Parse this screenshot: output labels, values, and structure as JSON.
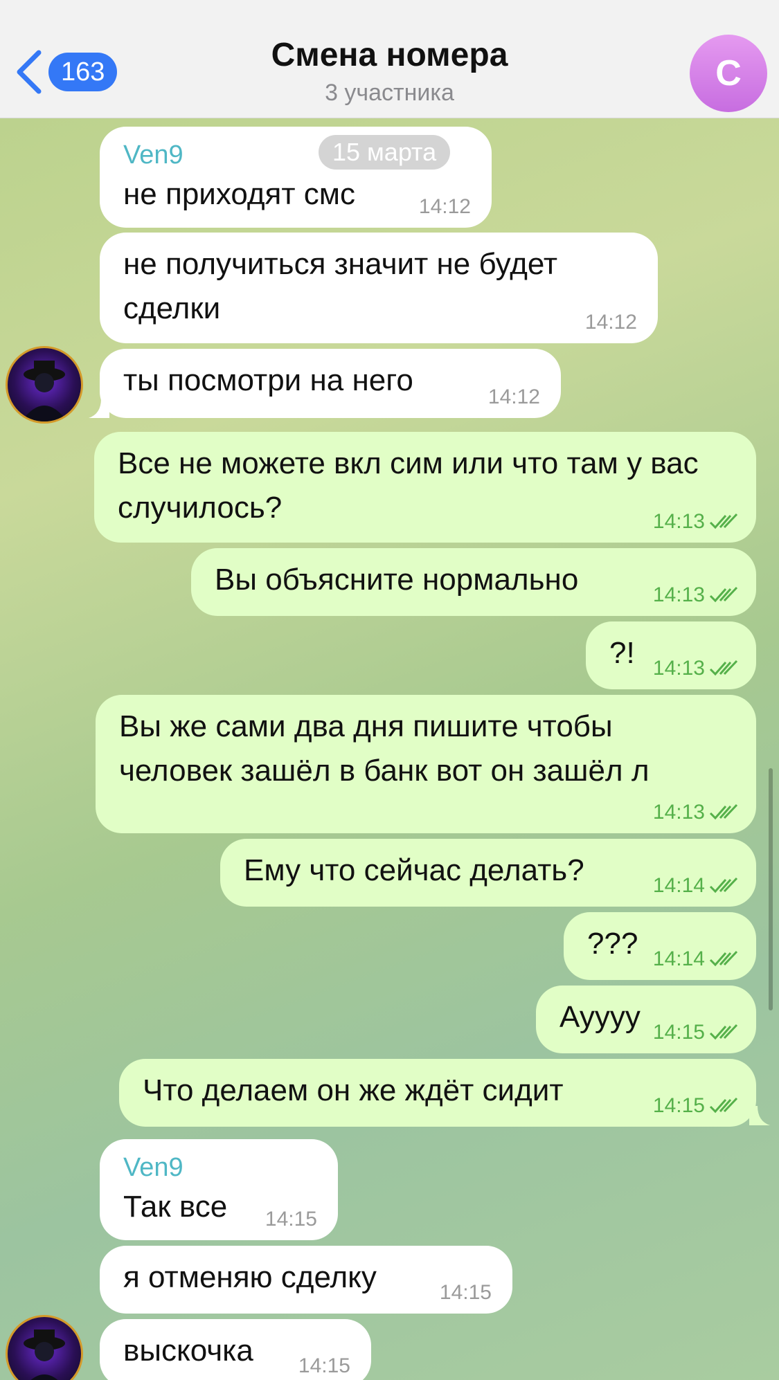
{
  "header": {
    "back_count": "163",
    "title": "Смена номера",
    "subtitle": "3 участника",
    "avatar_letter": "С"
  },
  "date_chip": "15 марта",
  "messages": [
    {
      "sender": "Ven9",
      "text": "не приходят смс",
      "time": "14:12",
      "out": false
    },
    {
      "text": "не получиться значит не будет сделки",
      "time": "14:12",
      "out": false
    },
    {
      "text": "ты посмотри на него",
      "time": "14:12",
      "out": false
    },
    {
      "text": "Все не можете вкл сим или что там у вас случилось?",
      "time": "14:13",
      "out": true
    },
    {
      "text": "Вы объясните нормально",
      "time": "14:13",
      "out": true
    },
    {
      "text": "?!",
      "time": "14:13",
      "out": true
    },
    {
      "text": "Вы же сами два дня пишите чтобы человек зашёл в банк вот он зашёл л",
      "time": "14:13",
      "out": true
    },
    {
      "text": "Ему что сейчас делать?",
      "time": "14:14",
      "out": true
    },
    {
      "text": "???",
      "time": "14:14",
      "out": true
    },
    {
      "text": "Ауууу",
      "time": "14:15",
      "out": true
    },
    {
      "text": "Что делаем он же ждёт сидит",
      "time": "14:15",
      "out": true
    },
    {
      "sender": "Ven9",
      "text": "Так все",
      "time": "14:15",
      "out": false
    },
    {
      "text": "я отменяю сделку",
      "time": "14:15",
      "out": false
    },
    {
      "text": "выскочка",
      "time": "14:15",
      "out": false
    }
  ],
  "colors": {
    "accent": "#3478f6",
    "outgoing_bubble": "#e1fec6",
    "incoming_bubble": "#ffffff",
    "sender_name": "#4fb7c5",
    "read_checks": "#55b04a"
  }
}
